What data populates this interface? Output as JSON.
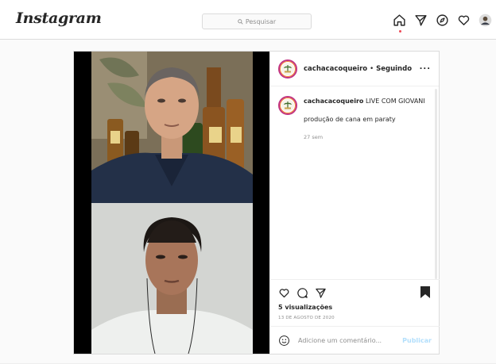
{
  "topbar": {
    "logo": "Instagram",
    "search_placeholder": "Pesquisar",
    "nav_icons": [
      "home-icon",
      "direct-icon",
      "explore-icon",
      "heart-icon",
      "profile-avatar"
    ]
  },
  "post": {
    "username": "cachacacoqueiro",
    "separator": "•",
    "follow_status": "Seguindo",
    "more_label": "...",
    "caption": {
      "username": "cachacacoqueiro",
      "text": "LIVE COM GIOVANI",
      "line2": "produção de cana em paraty",
      "time": "27 sem"
    },
    "views": "5 visualizações",
    "date": "13 DE AGOSTO DE 2020",
    "comment_placeholder": "Adicione um comentário...",
    "publish_label": "Publicar"
  },
  "colors": {
    "link_blue_disabled": "#b2dffc",
    "notification_red": "#ed4956",
    "border": "#dbdbdb"
  }
}
